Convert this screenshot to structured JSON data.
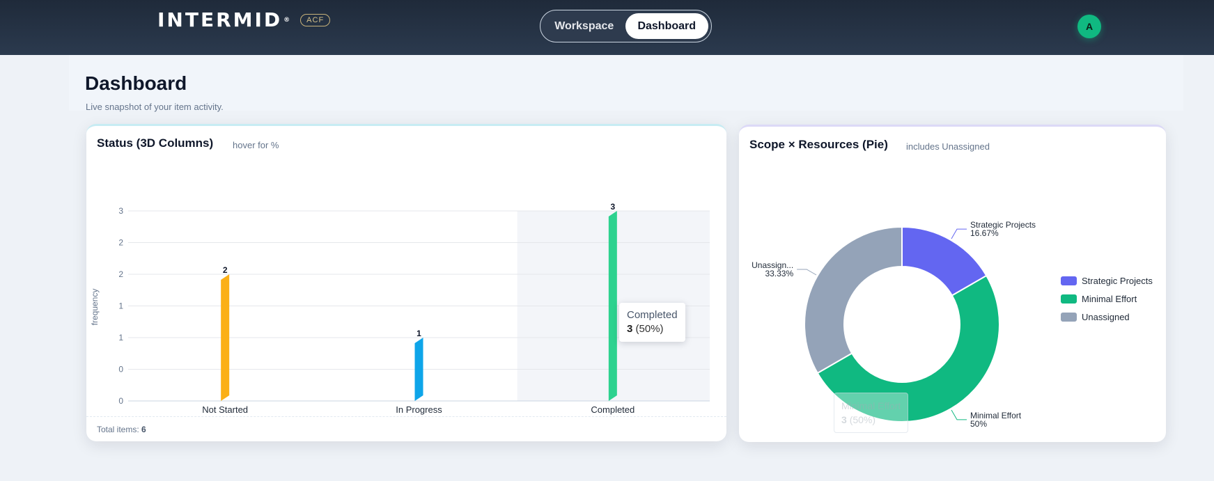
{
  "header": {
    "brand": "INTERMID",
    "brand_mark": "®",
    "badge": "ACF",
    "tabs": [
      {
        "label": "Workspace",
        "active": false
      },
      {
        "label": "Dashboard",
        "active": true
      }
    ],
    "avatar_initial": "A"
  },
  "page": {
    "title": "Dashboard",
    "subtitle": "Live snapshot of your item activity."
  },
  "status_card": {
    "title": "Status (3D Columns)",
    "hint": "hover for %",
    "footer_label": "Total items:",
    "footer_value": "6",
    "tooltip": {
      "title": "Completed",
      "value": "3",
      "pct": "(50%)"
    }
  },
  "pie_card": {
    "title": "Scope × Resources (Pie)",
    "hint": "includes Unassigned",
    "ghost_tooltip": {
      "title": "Minimal Effort",
      "value": "3",
      "pct": "(50%)"
    }
  },
  "colors": {
    "not_started": "#fbb017",
    "in_progress": "#0ea5e9",
    "completed": "#2dd28f",
    "strategic": "#6366f1",
    "minimal": "#10b981",
    "unassigned": "#94a3b8"
  },
  "chart_data": [
    {
      "type": "bar",
      "title": "Status (3D Columns)",
      "ylabel": "frequency",
      "categories": [
        "Not Started",
        "In Progress",
        "Completed"
      ],
      "values": [
        2,
        1,
        3
      ],
      "data_labels": [
        "2",
        "1",
        "3"
      ],
      "ytick_labels": [
        "0",
        "0",
        "1",
        "1",
        "2",
        "2",
        "3"
      ],
      "ylim": [
        0,
        3
      ],
      "grid": true,
      "highlighted_category": "Completed"
    },
    {
      "type": "pie",
      "title": "Scope × Resources (Pie)",
      "labels": [
        "Strategic Projects",
        "Minimal Effort",
        "Unassigned"
      ],
      "callout_labels": [
        "Strategic Projects",
        "Minimal Effort",
        "Unassign..."
      ],
      "values": [
        1,
        3,
        2
      ],
      "percent_labels": [
        "16.67%",
        "50%",
        "33.33%"
      ],
      "donut": true,
      "legend": "right"
    }
  ]
}
